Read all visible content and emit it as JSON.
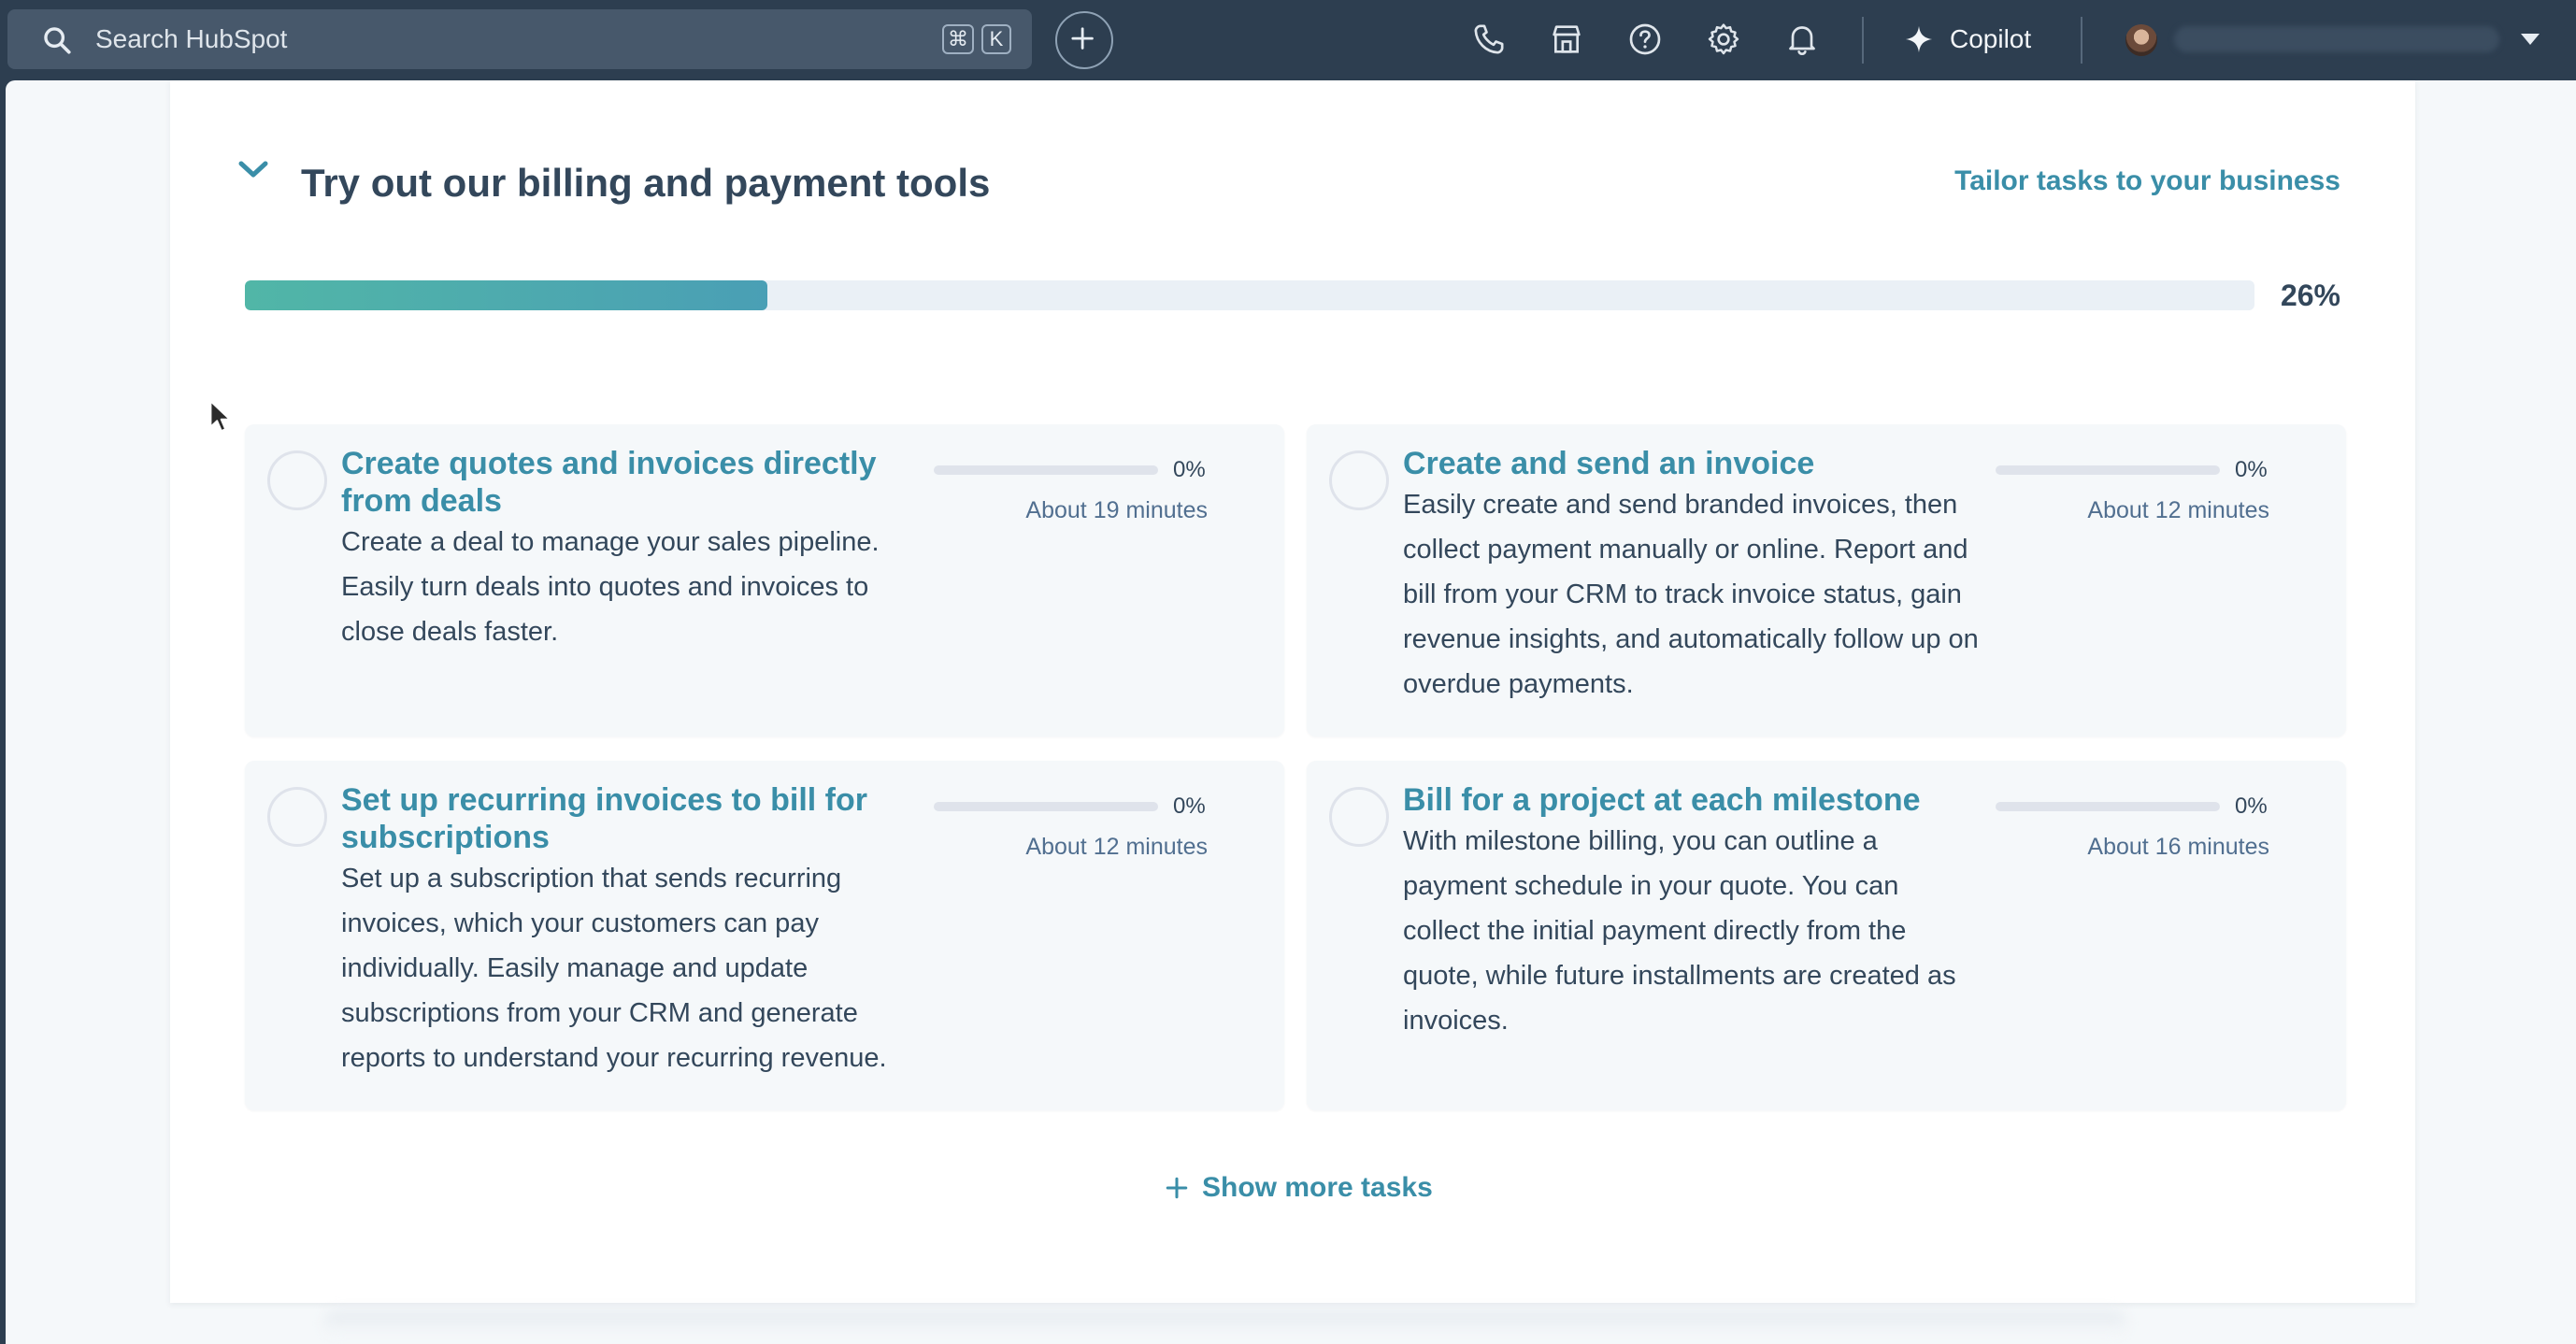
{
  "topbar": {
    "search_placeholder": "Search HubSpot",
    "shortcut_keys": [
      "⌘",
      "K"
    ],
    "copilot_label": "Copilot"
  },
  "section": {
    "title": "Try out our billing and payment tools",
    "tailor_link": "Tailor tasks to your business",
    "progress_percent_label": "26%",
    "progress_fraction": 0.26
  },
  "tasks": [
    {
      "title": "Create quotes and invoices directly from deals",
      "description": "Create a deal to manage your sales pipeline. Easily turn deals into quotes and invoices to close deals faster.",
      "progress_label": "0%",
      "duration": "About 19 minutes"
    },
    {
      "title": "Create and send an invoice",
      "description": "Easily create and send branded invoices, then collect payment manually or online. Report and bill from your CRM to track invoice status, gain revenue insights, and automatically follow up on overdue payments.",
      "progress_label": "0%",
      "duration": "About 12 minutes"
    },
    {
      "title": "Set up recurring invoices to bill for subscriptions",
      "description": "Set up a subscription that sends recurring invoices, which your customers can pay individually. Easily manage and update subscriptions from your CRM and generate reports to understand your recurring revenue.",
      "progress_label": "0%",
      "duration": "About 12 minutes"
    },
    {
      "title": "Bill for a project at each milestone",
      "description": "With milestone billing, you can outline a payment schedule in your quote. You can collect the initial payment directly from the quote, while future installments are created as invoices.",
      "progress_label": "0%",
      "duration": "About 16 minutes"
    }
  ],
  "show_more_label": "Show more tasks",
  "colors": {
    "nav_bg": "#2d3e50",
    "link": "#3a8ea8",
    "text": "#33475b",
    "tile_bg": "#f5f8fa",
    "progress_fill_start": "#51b6a7",
    "progress_fill_end": "#4a9fb5"
  }
}
